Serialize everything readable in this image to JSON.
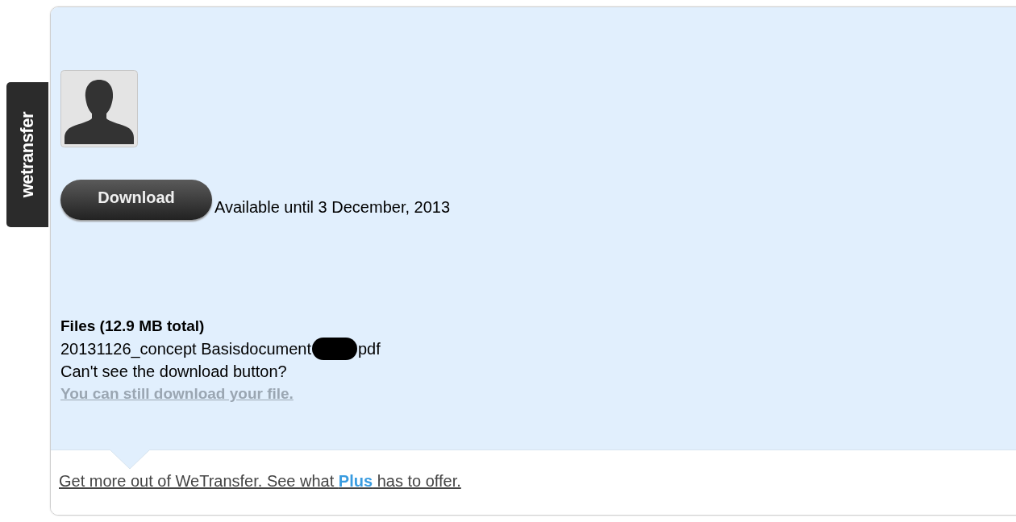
{
  "logo": {
    "text": "wetransfer"
  },
  "download": {
    "button": "Download",
    "availability": "Available until 3 December, 2013"
  },
  "files": {
    "heading": "Files (12.9 MB total)",
    "name_before": "20131126_concept Basisdocument",
    "name_redacted": true,
    "name_after": "pdf",
    "help": "Can't see the download button?",
    "link": "You can still download your file."
  },
  "footer": {
    "promo": "Get more out of WeTransfer. See what **Plus** has to offer."
  }
}
